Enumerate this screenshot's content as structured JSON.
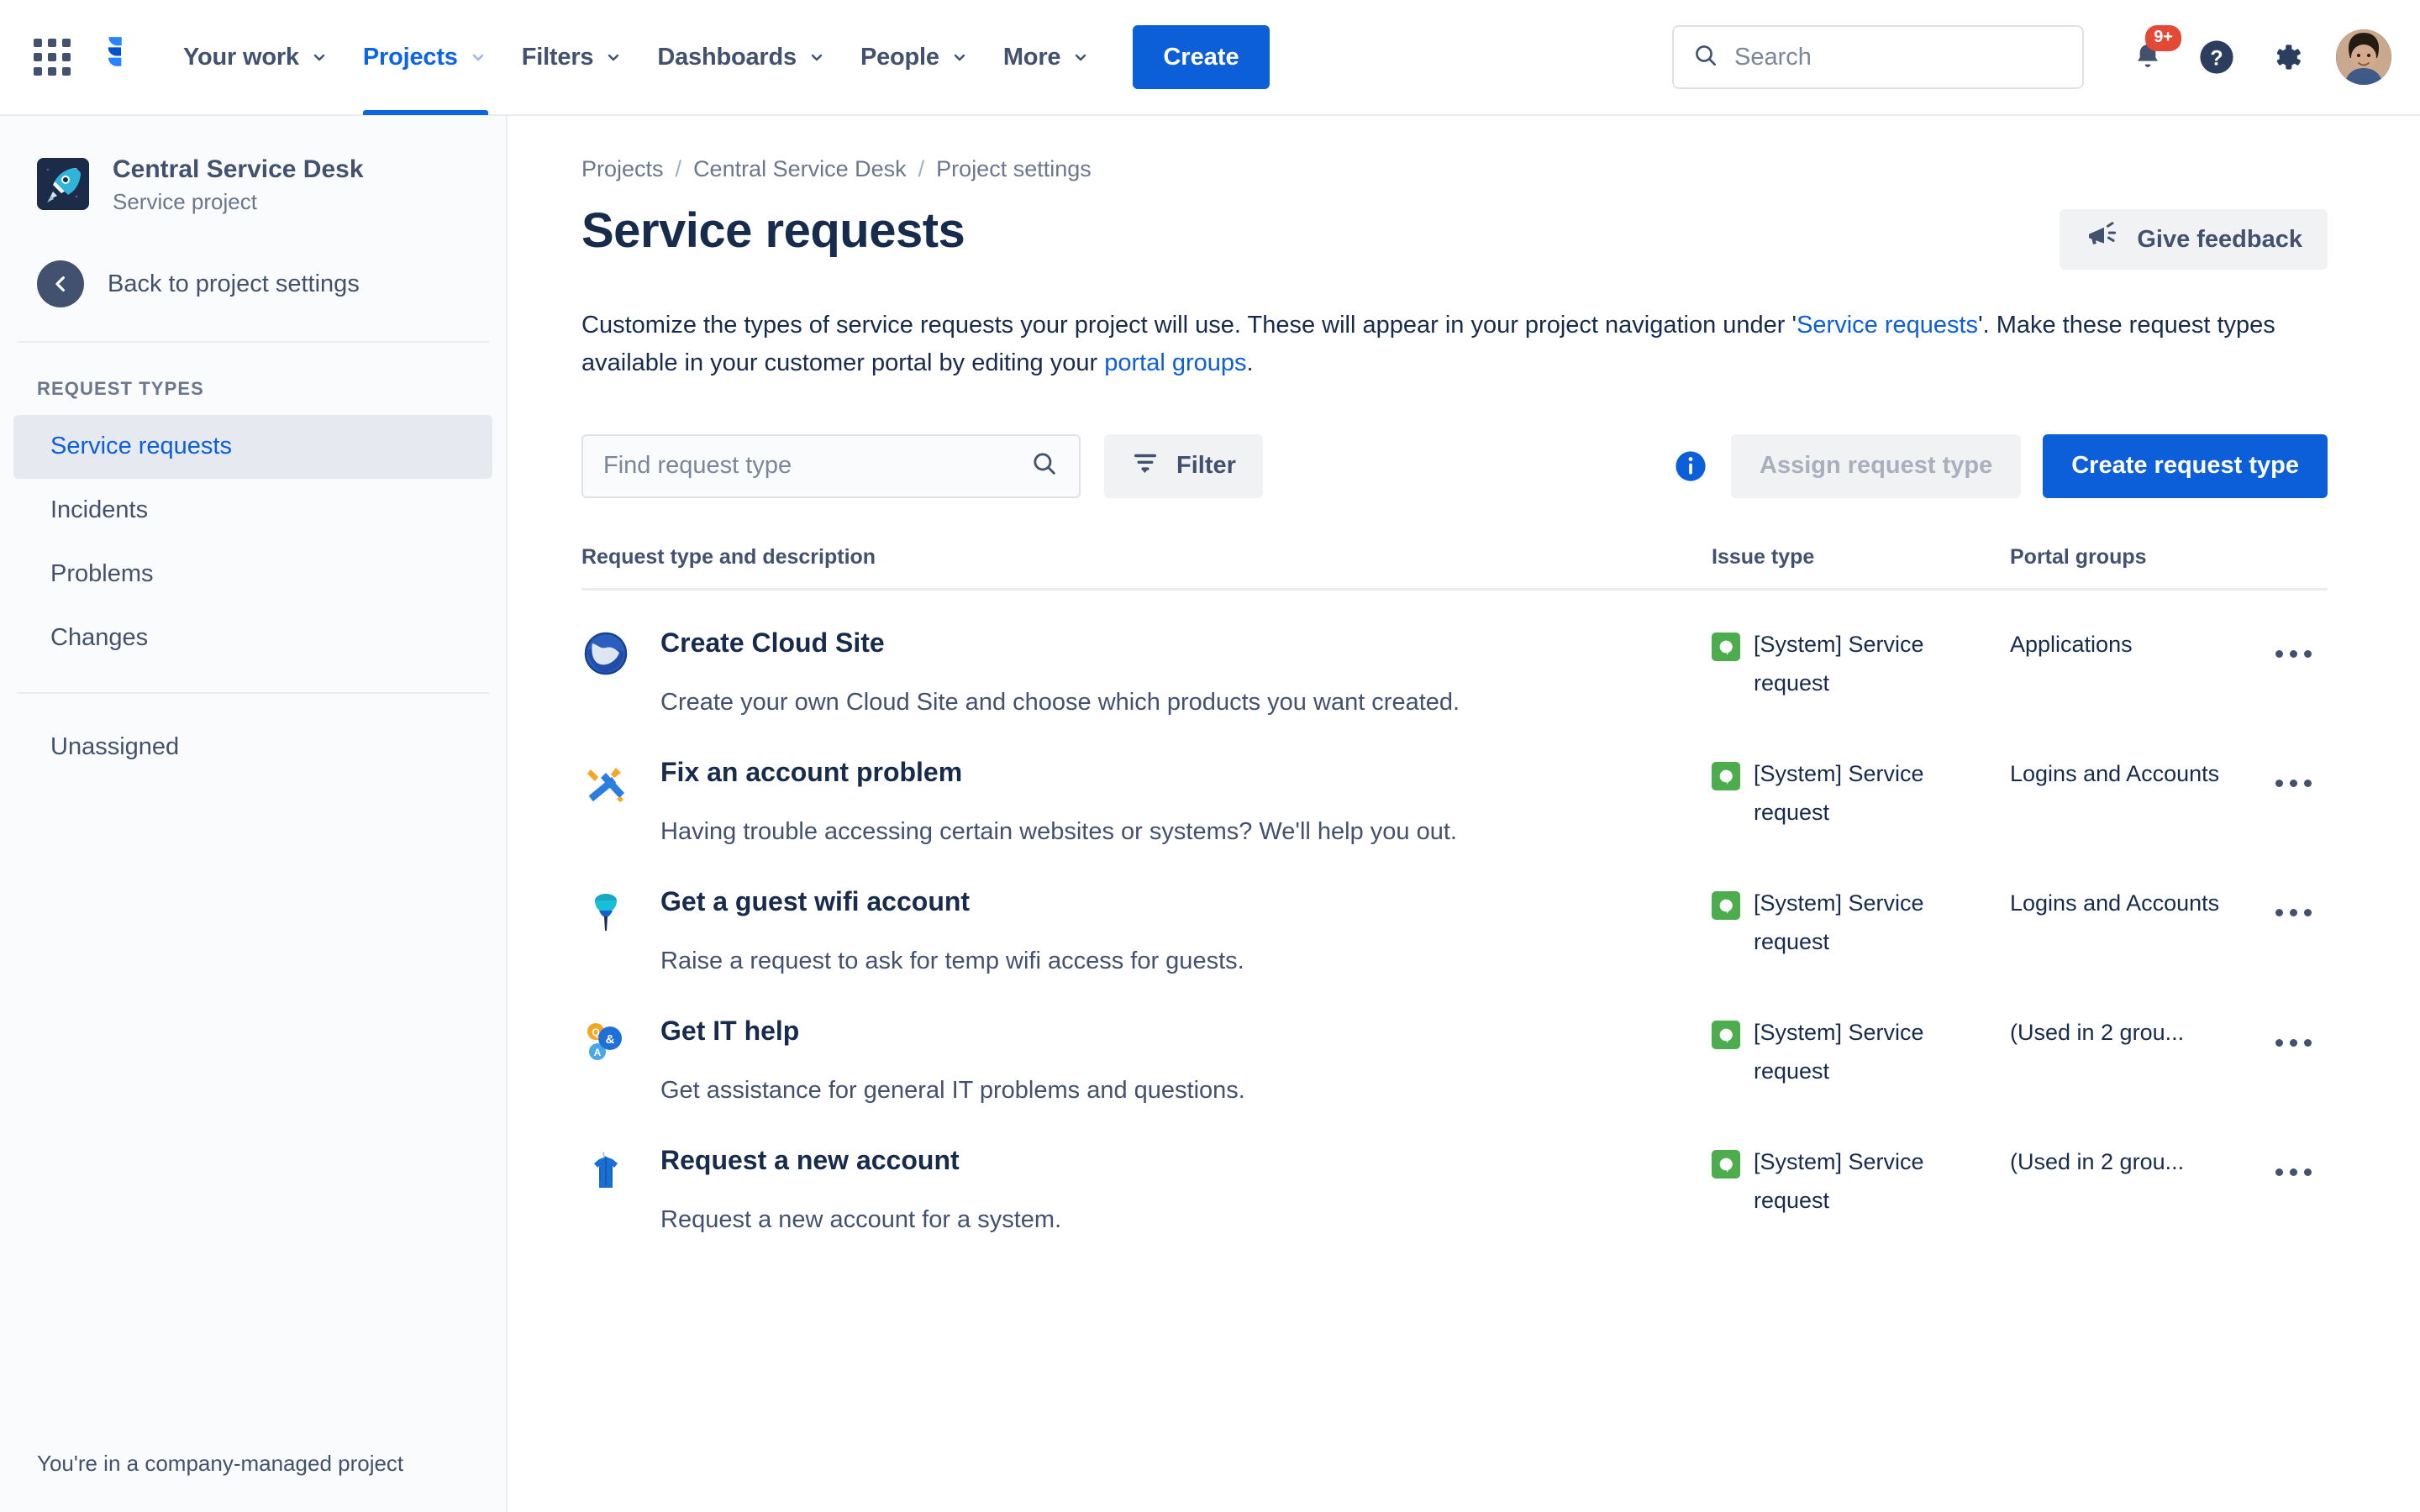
{
  "topnav": {
    "app_switcher_label": "App switcher",
    "logo_label": "Jira",
    "items": [
      {
        "label": "Your work",
        "active": false
      },
      {
        "label": "Projects",
        "active": true
      },
      {
        "label": "Filters",
        "active": false
      },
      {
        "label": "Dashboards",
        "active": false
      },
      {
        "label": "People",
        "active": false
      },
      {
        "label": "More",
        "active": false
      }
    ],
    "create_label": "Create",
    "search_placeholder": "Search",
    "search_value": "",
    "notifications_badge": "9+",
    "help_label": "Help",
    "settings_label": "Settings",
    "avatar_label": "Your profile"
  },
  "sidebar": {
    "project_name": "Central Service Desk",
    "project_type": "Service project",
    "back_label": "Back to project settings",
    "section_title": "REQUEST TYPES",
    "items": [
      {
        "label": "Service requests",
        "active": true
      },
      {
        "label": "Incidents",
        "active": false
      },
      {
        "label": "Problems",
        "active": false
      },
      {
        "label": "Changes",
        "active": false
      }
    ],
    "unassigned_label": "Unassigned",
    "footer": "You're in a company-managed project"
  },
  "breadcrumb": [
    {
      "label": "Projects"
    },
    {
      "label": "Central Service Desk"
    },
    {
      "label": "Project settings"
    }
  ],
  "breadcrumb_separator": "/",
  "page": {
    "title": "Service requests",
    "feedback_label": "Give feedback",
    "description_part1": "Customize the types of service requests your project will use. These will appear in your project navigation under '",
    "description_link1": "Service requests",
    "description_part2": "'. Make these request types available in your customer portal by editing your ",
    "description_link2": "portal groups",
    "description_part3": "."
  },
  "toolbar": {
    "find_placeholder": "Find request type",
    "find_value": "",
    "filter_label": "Filter",
    "assign_label": "Assign request type",
    "create_label": "Create request type"
  },
  "table": {
    "columns": {
      "name": "Request type and description",
      "issue_type": "Issue type",
      "portal_groups": "Portal groups"
    },
    "rows": [
      {
        "icon": "globe-icon",
        "title": "Create Cloud Site",
        "description": "Create your own Cloud Site and choose which products you want created.",
        "issue_type": "[System] Service request",
        "portal_groups": "Applications"
      },
      {
        "icon": "tools-icon",
        "title": "Fix an account problem",
        "description": "Having trouble accessing certain websites or systems? We'll help you out.",
        "issue_type": "[System] Service request",
        "portal_groups": "Logins and Accounts"
      },
      {
        "icon": "wifi-antenna-icon",
        "title": "Get a guest wifi account",
        "description": "Raise a request to ask for temp wifi access for guests.",
        "issue_type": "[System] Service request",
        "portal_groups": "Logins and Accounts"
      },
      {
        "icon": "support-bubbles-icon",
        "title": "Get IT help",
        "description": "Get assistance for general IT problems and questions.",
        "issue_type": "[System] Service request",
        "portal_groups": "(Used in 2 grou..."
      },
      {
        "icon": "shirt-icon",
        "title": "Request a new account",
        "description": "Request a new account for a system.",
        "issue_type": "[System] Service request",
        "portal_groups": "(Used in 2 grou..."
      }
    ],
    "row_menu_label": "More actions"
  },
  "colors": {
    "brand_blue": "#0c5ed9",
    "link_blue": "#0c66e4",
    "text_dark": "#172b4d",
    "text_muted": "#6b778c",
    "badge_red": "#e34935",
    "issue_green": "#4bad4b",
    "sidebar_bg": "#fafbfc"
  }
}
